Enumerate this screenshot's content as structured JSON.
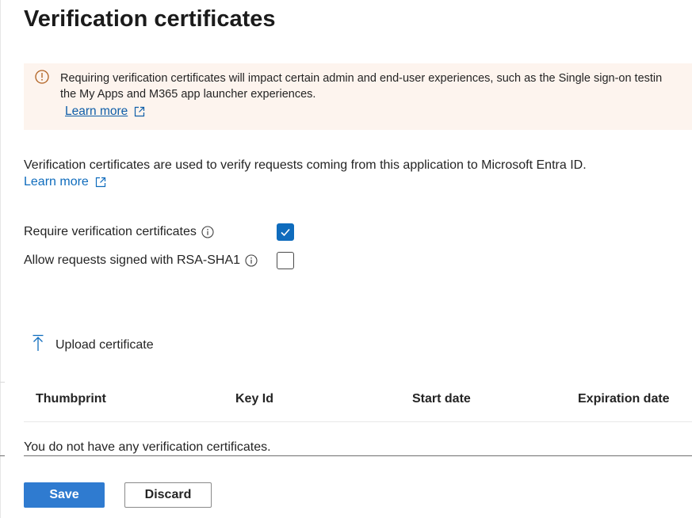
{
  "page": {
    "title": "Verification certificates"
  },
  "banner": {
    "line1": "Requiring verification certificates will impact certain admin and end-user experiences, such as the Single sign-on testin",
    "line2": "the My Apps and M365 app launcher experiences.",
    "link_label": "Learn more",
    "icon": "warning-info-icon",
    "background_color": "#fdf4ee",
    "icon_color": "#b0601f"
  },
  "description": {
    "text": "Verification certificates are used to verify requests coming from this application to Microsoft Entra ID.",
    "link_label": "Learn more"
  },
  "options": {
    "require_verification": {
      "label": "Require verification certificates",
      "checked": true
    },
    "allow_rsa_sha1": {
      "label": "Allow requests signed with RSA-SHA1",
      "checked": false
    }
  },
  "toolbar": {
    "upload_label": "Upload certificate",
    "upload_icon": "upload-arrow-icon"
  },
  "table": {
    "columns": [
      "Thumbprint",
      "Key Id",
      "Start date",
      "Expiration date"
    ],
    "empty_message": "You do not have any verification certificates."
  },
  "actions": {
    "save_label": "Save",
    "discard_label": "Discard"
  },
  "colors": {
    "accent": "#0f6cbd",
    "save_button": "#2f7bd0"
  }
}
